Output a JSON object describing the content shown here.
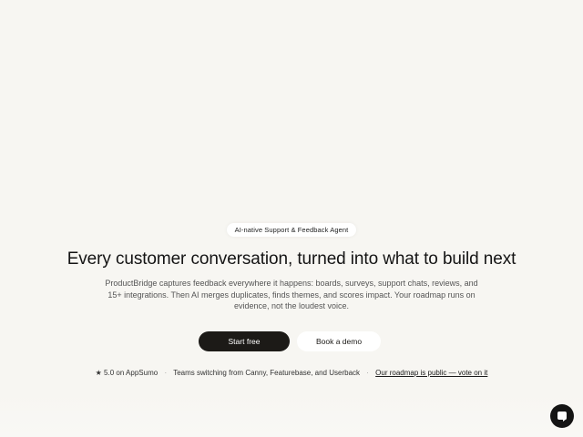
{
  "hero": {
    "badge": "AI-native Support & Feedback Agent",
    "title": "Every customer conversation, turned into what to build next",
    "subtitle": "ProductBridge captures feedback everywhere it happens: boards, surveys, support chats, reviews, and 15+ integrations. Then AI merges duplicates, finds themes, and scores impact. Your roadmap runs on evidence, not the loudest voice.",
    "primary_cta": "Start free",
    "secondary_cta": "Book a demo"
  },
  "proof": {
    "rating": "★ 5.0 on AppSumo",
    "separator": "·",
    "switching": "Teams switching from Canny, Featurebase, and Userback",
    "roadmap_link": "Our roadmap is public — vote on it"
  },
  "chat": {
    "icon": "chat-bubble-icon"
  },
  "colors": {
    "background": "#f7f6f2",
    "primary_button": "#1c1a17",
    "chat_launcher": "#141414"
  }
}
